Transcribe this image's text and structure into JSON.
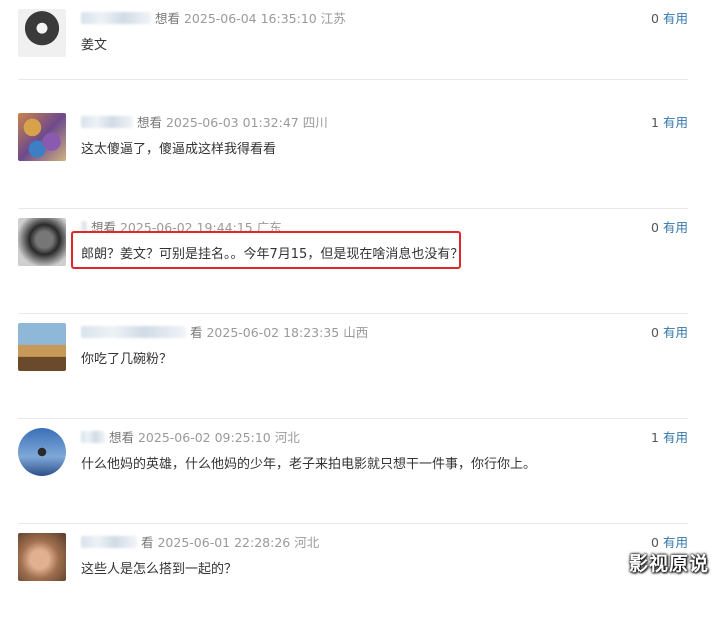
{
  "comments": [
    {
      "want": "想看",
      "date": "2025-06-04 16:35:10",
      "region": "江苏",
      "text": "姜文",
      "count": "0",
      "useful": "有用"
    },
    {
      "want": "想看",
      "date": "2025-06-03 01:32:47",
      "region": "四川",
      "text": "这太傻逼了，傻逼成这样我得看看",
      "count": "1",
      "useful": "有用"
    },
    {
      "want": "想看",
      "date": "2025-06-02 19:44:15",
      "region": "广东",
      "text": "郎朗？姜文？可别是挂名。。今年7月15，但是现在啥消息也没有？",
      "count": "0",
      "useful": "有用"
    },
    {
      "want": "看",
      "date": "2025-06-02 18:23:35",
      "region": "山西",
      "text": "你吃了几碗粉？",
      "count": "0",
      "useful": "有用"
    },
    {
      "want": "想看",
      "date": "2025-06-02 09:25:10",
      "region": "河北",
      "text": "什么他妈的英雄，什么他妈的少年，老子来拍电影就只想干一件事，你行你上。",
      "count": "1",
      "useful": "有用"
    },
    {
      "want": "看",
      "date": "2025-06-01 22:28:26",
      "region": "河北",
      "text": "这些人是怎么搭到一起的？",
      "count": "0",
      "useful": "有用"
    }
  ],
  "watermark": "影视原说",
  "colors": {
    "link": "#3377aa",
    "highlight": "#e0252b",
    "meta": "#9a9a9a"
  }
}
